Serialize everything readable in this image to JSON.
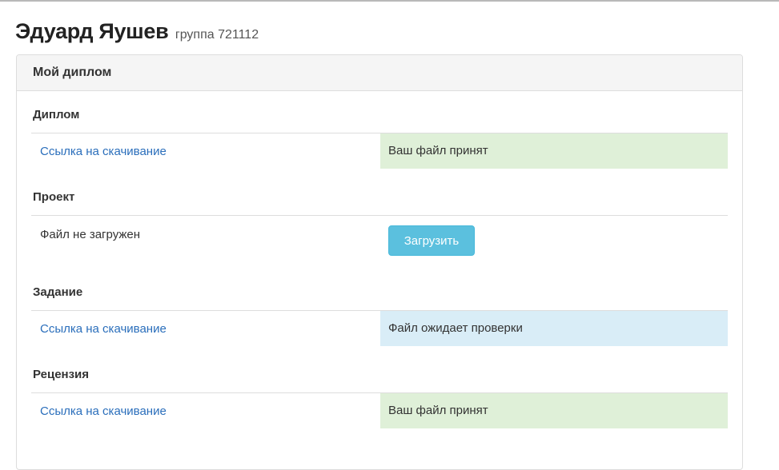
{
  "header": {
    "name": "Эдуард Яушев",
    "group": "группа 721112"
  },
  "panel": {
    "title": "Мой диплом"
  },
  "sections": {
    "diploma": {
      "title": "Диплом",
      "link": "Ссылка на скачивание",
      "status": "Ваш файл принят"
    },
    "project": {
      "title": "Проект",
      "file_text": "Файл не загружен",
      "upload_label": "Загрузить"
    },
    "task": {
      "title": "Задание",
      "link": "Ссылка на скачивание",
      "status": "Файл ожидает проверки"
    },
    "review": {
      "title": "Рецензия",
      "link": "Ссылка на скачивание",
      "status": "Ваш файл принят"
    }
  },
  "colors": {
    "success_bg": "#dff0d8",
    "info_bg": "#d9edf7",
    "link": "#2a6ebb",
    "button": "#5bc0de"
  }
}
